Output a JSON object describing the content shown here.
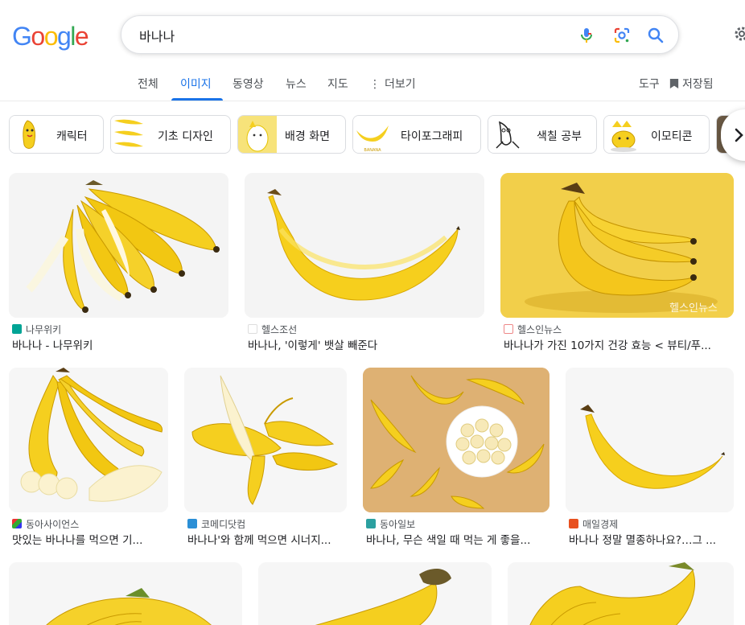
{
  "logo": {
    "letters": [
      "G",
      "o",
      "o",
      "g",
      "l",
      "e"
    ],
    "colors": [
      "#4285f4",
      "#ea4335",
      "#fbbc05",
      "#4285f4",
      "#34a853",
      "#ea4335"
    ]
  },
  "search": {
    "query": "바나나",
    "icons": [
      "mic-icon",
      "lens-icon",
      "search-icon"
    ]
  },
  "tabs": [
    "전체",
    "이미지",
    "동영상",
    "뉴스",
    "지도",
    "더보기"
  ],
  "tools": {
    "tools_label": "도구",
    "saved_label": "저장됨"
  },
  "chips": [
    "캐릭터",
    "기초 디자인",
    "배경 화면",
    "타이포그래피",
    "색칠 공부",
    "이모티콘"
  ],
  "results": [
    {
      "source": "나무위키",
      "title": "바나나 - 나무위키"
    },
    {
      "source": "헬스조선",
      "title": "바나나, '이렇게' 뱃살 빼준다"
    },
    {
      "source": "헬스인뉴스",
      "title": "바나나가 가진 10가지 건강 효능 < 뷰티/푸...",
      "watermark": "헬스인뉴스"
    },
    {
      "source": "동아사이언스",
      "title": "맛있는 바나나를 먹으면 기..."
    },
    {
      "source": "코메디닷컴",
      "title": "바나나'와 함께 먹으면 시너지..."
    },
    {
      "source": "동아일보",
      "title": "바나나, 무슨 색일 때 먹는 게 좋을..."
    },
    {
      "source": "매일경제",
      "title": "바나나 정말 멸종하나요?…그 ..."
    }
  ],
  "colors": {
    "accent": "#1a73e8",
    "banana": "#f5cf1f",
    "banana_dark": "#d9a300"
  }
}
